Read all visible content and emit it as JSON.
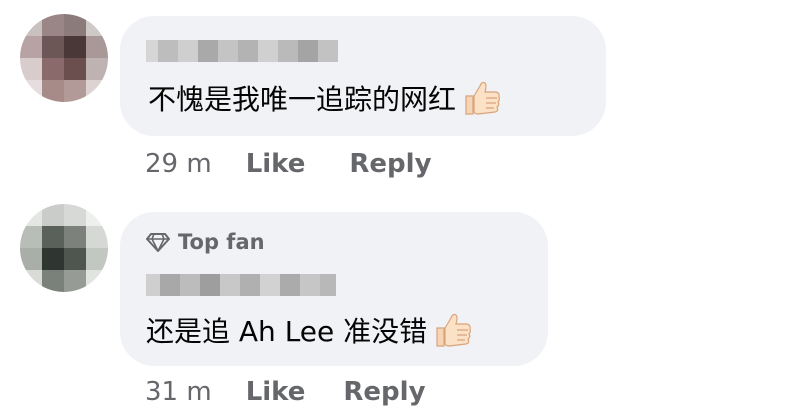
{
  "comments": [
    {
      "author_name": "",
      "top_fan": "",
      "text": "不愧是我唯一追踪的网红",
      "emoji": "thumbs-up",
      "time": "29 m",
      "like_label": "Like",
      "reply_label": "Reply"
    },
    {
      "author_name": "",
      "top_fan": "Top fan",
      "text": "还是追 Ah Lee 准没错",
      "emoji": "thumbs-up",
      "time": "31 m",
      "like_label": "Like",
      "reply_label": "Reply"
    }
  ],
  "colors": {
    "bubble": "#f0f2f5",
    "text": "#050505",
    "secondary": "#65676b"
  }
}
